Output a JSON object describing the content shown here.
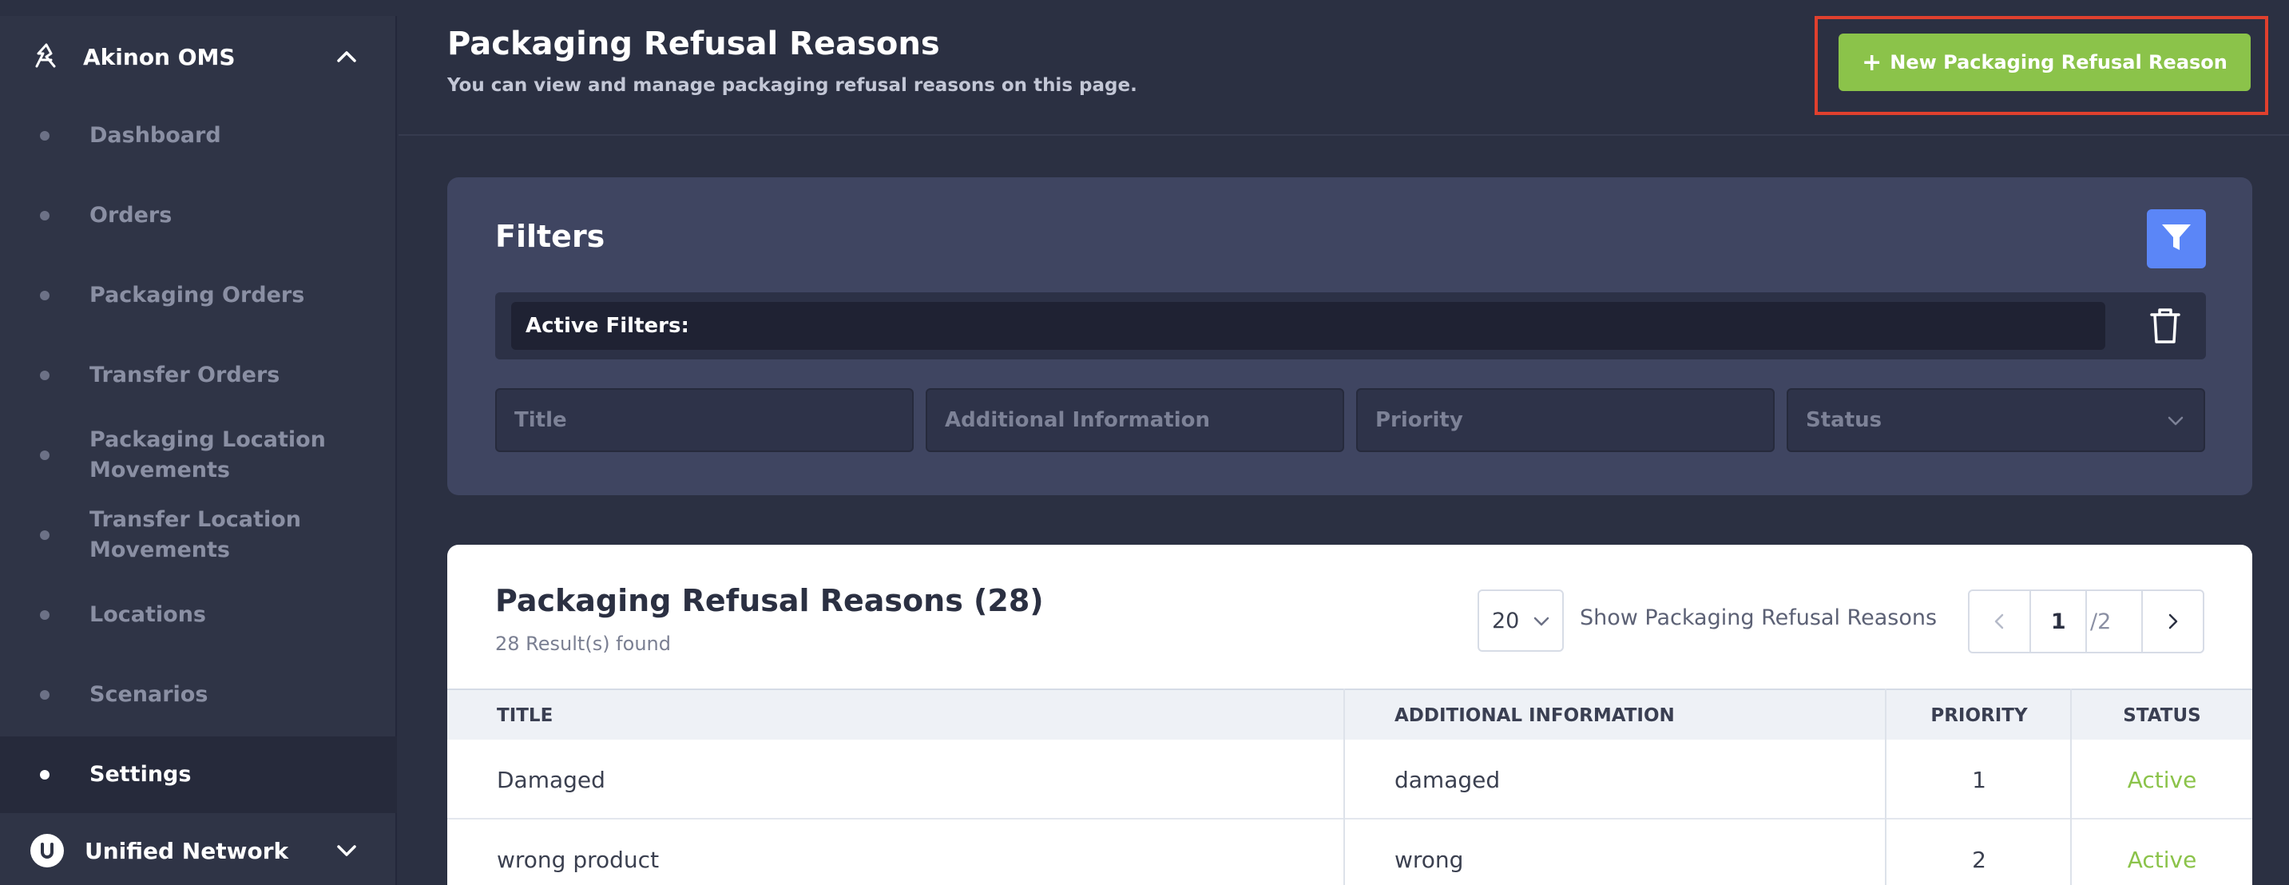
{
  "sidebar": {
    "app_title": "Akinon OMS",
    "items": [
      {
        "label": "Dashboard"
      },
      {
        "label": "Orders"
      },
      {
        "label": "Packaging Orders"
      },
      {
        "label": "Transfer Orders"
      },
      {
        "label": "Packaging Location Movements"
      },
      {
        "label": "Transfer Location Movements"
      },
      {
        "label": "Locations"
      },
      {
        "label": "Scenarios"
      },
      {
        "label": "Settings",
        "active": true
      }
    ],
    "footer_title": "Unified Network"
  },
  "header": {
    "title": "Packaging Refusal Reasons",
    "subtitle": "You can view and manage packaging refusal reasons on this page.",
    "new_button_label": "New Packaging Refusal Reason"
  },
  "filters": {
    "title": "Filters",
    "active_label": "Active Filters:",
    "fields": [
      {
        "placeholder": "Title"
      },
      {
        "placeholder": "Additional Information"
      },
      {
        "placeholder": "Priority"
      },
      {
        "placeholder": "Status"
      }
    ]
  },
  "table": {
    "title": "Packaging Refusal Reasons (28)",
    "results": "28 Result(s) found",
    "per_page": "20",
    "per_page_label": "Show Packaging Refusal Reasons",
    "page": "1",
    "total_pages": "/2",
    "columns": [
      "TITLE",
      "ADDITIONAL INFORMATION",
      "PRIORITY",
      "STATUS"
    ],
    "rows": [
      {
        "title": "Damaged",
        "info": "damaged",
        "priority": "1",
        "status": "Active"
      },
      {
        "title": "wrong product",
        "info": "wrong",
        "priority": "2",
        "status": "Active"
      }
    ]
  },
  "colors": {
    "accent_green": "#8bc34a",
    "filter_blue": "#5b86f7",
    "highlight_red": "#e0402e"
  }
}
